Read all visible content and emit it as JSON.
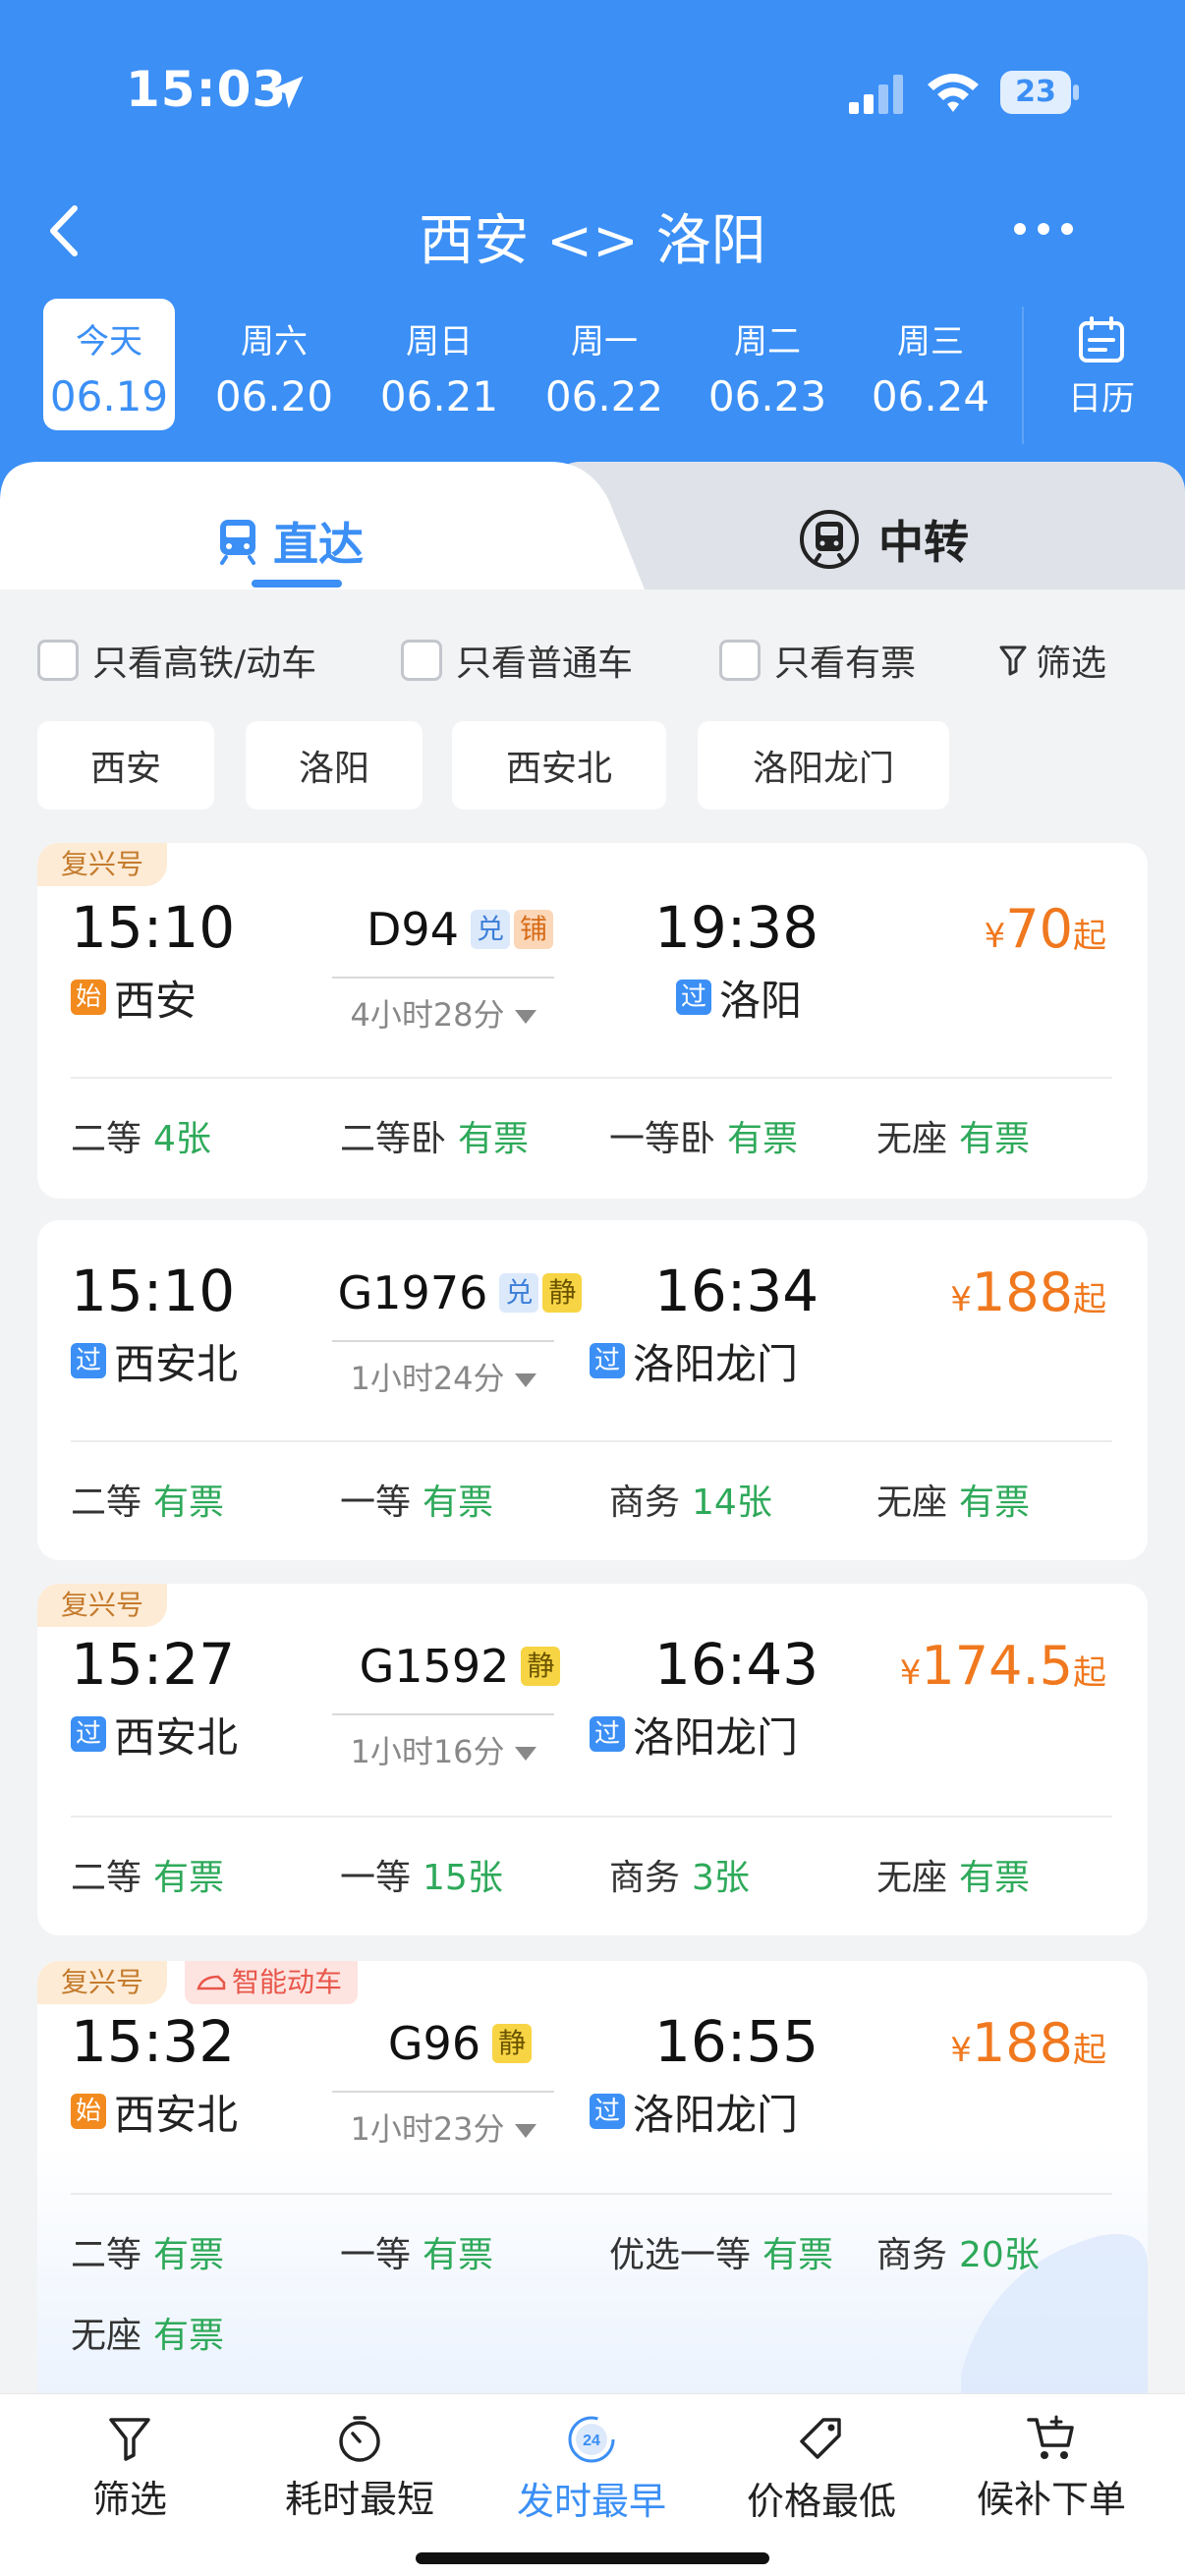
{
  "status_bar": {
    "time": "15:03",
    "battery": "23"
  },
  "nav": {
    "title": "西安 <> 洛阳"
  },
  "dates": [
    {
      "weekday": "今天",
      "date": "06.19"
    },
    {
      "weekday": "周六",
      "date": "06.20"
    },
    {
      "weekday": "周日",
      "date": "06.21"
    },
    {
      "weekday": "周一",
      "date": "06.22"
    },
    {
      "weekday": "周二",
      "date": "06.23"
    },
    {
      "weekday": "周三",
      "date": "06.24"
    }
  ],
  "calendar_label": "日历",
  "tabs": {
    "direct": "直达",
    "transfer": "中转"
  },
  "filters": {
    "high_speed_only": "只看高铁/动车",
    "regular_only": "只看普通车",
    "available_only": "只看有票",
    "filter": "筛选"
  },
  "stations": [
    "西安",
    "洛阳",
    "西安北",
    "洛阳龙门"
  ],
  "trains": [
    {
      "tag": "复兴号",
      "dep_time": "15:10",
      "dep_badge": "始",
      "dep_station": "西安",
      "train_no": "D94",
      "mini_tags": [
        "兑",
        "铺"
      ],
      "duration": "4小时28分",
      "arr_time": "19:38",
      "arr_badge": "过",
      "arr_station": "洛阳",
      "price_symbol": "¥",
      "price": "70",
      "price_suffix": "起",
      "seats": [
        {
          "name": "二等",
          "status": "4张"
        },
        {
          "name": "二等卧",
          "status": "有票"
        },
        {
          "name": "一等卧",
          "status": "有票"
        },
        {
          "name": "无座",
          "status": "有票"
        }
      ]
    },
    {
      "tag": "",
      "dep_time": "15:10",
      "dep_badge": "过",
      "dep_station": "西安北",
      "train_no": "G1976",
      "mini_tags": [
        "兑",
        "静"
      ],
      "duration": "1小时24分",
      "arr_time": "16:34",
      "arr_badge": "过",
      "arr_station": "洛阳龙门",
      "price_symbol": "¥",
      "price": "188",
      "price_suffix": "起",
      "seats": [
        {
          "name": "二等",
          "status": "有票"
        },
        {
          "name": "一等",
          "status": "有票"
        },
        {
          "name": "商务",
          "status": "14张"
        },
        {
          "name": "无座",
          "status": "有票"
        }
      ]
    },
    {
      "tag": "复兴号",
      "dep_time": "15:27",
      "dep_badge": "过",
      "dep_station": "西安北",
      "train_no": "G1592",
      "mini_tags": [
        "静"
      ],
      "duration": "1小时16分",
      "arr_time": "16:43",
      "arr_badge": "过",
      "arr_station": "洛阳龙门",
      "price_symbol": "¥",
      "price": "174.5",
      "price_suffix": "起",
      "seats": [
        {
          "name": "二等",
          "status": "有票"
        },
        {
          "name": "一等",
          "status": "15张"
        },
        {
          "name": "商务",
          "status": "3张"
        },
        {
          "name": "无座",
          "status": "有票"
        }
      ]
    },
    {
      "tag": "复兴号",
      "tag2": "智能动车",
      "dep_time": "15:32",
      "dep_badge": "始",
      "dep_station": "西安北",
      "train_no": "G96",
      "mini_tags": [
        "静"
      ],
      "duration": "1小时23分",
      "arr_time": "16:55",
      "arr_badge": "过",
      "arr_station": "洛阳龙门",
      "price_symbol": "¥",
      "price": "188",
      "price_suffix": "起",
      "seats": [
        {
          "name": "二等",
          "status": "有票"
        },
        {
          "name": "一等",
          "status": "有票"
        },
        {
          "name": "优选一等",
          "status": "有票"
        },
        {
          "name": "商务",
          "status": "20张"
        },
        {
          "name": "无座",
          "status": "有票"
        }
      ]
    }
  ],
  "bottom_bar": [
    {
      "label": "筛选",
      "icon": "filter-icon"
    },
    {
      "label": "耗时最短",
      "icon": "timer-icon"
    },
    {
      "label": "发时最早",
      "icon": "clock-24-icon",
      "badge": "24"
    },
    {
      "label": "价格最低",
      "icon": "price-tag-icon"
    },
    {
      "label": "候补下单",
      "icon": "cart-plus-icon"
    }
  ],
  "colors": {
    "primary": "#3b8ff5",
    "price": "#f0781e",
    "available": "#2ea95a"
  }
}
